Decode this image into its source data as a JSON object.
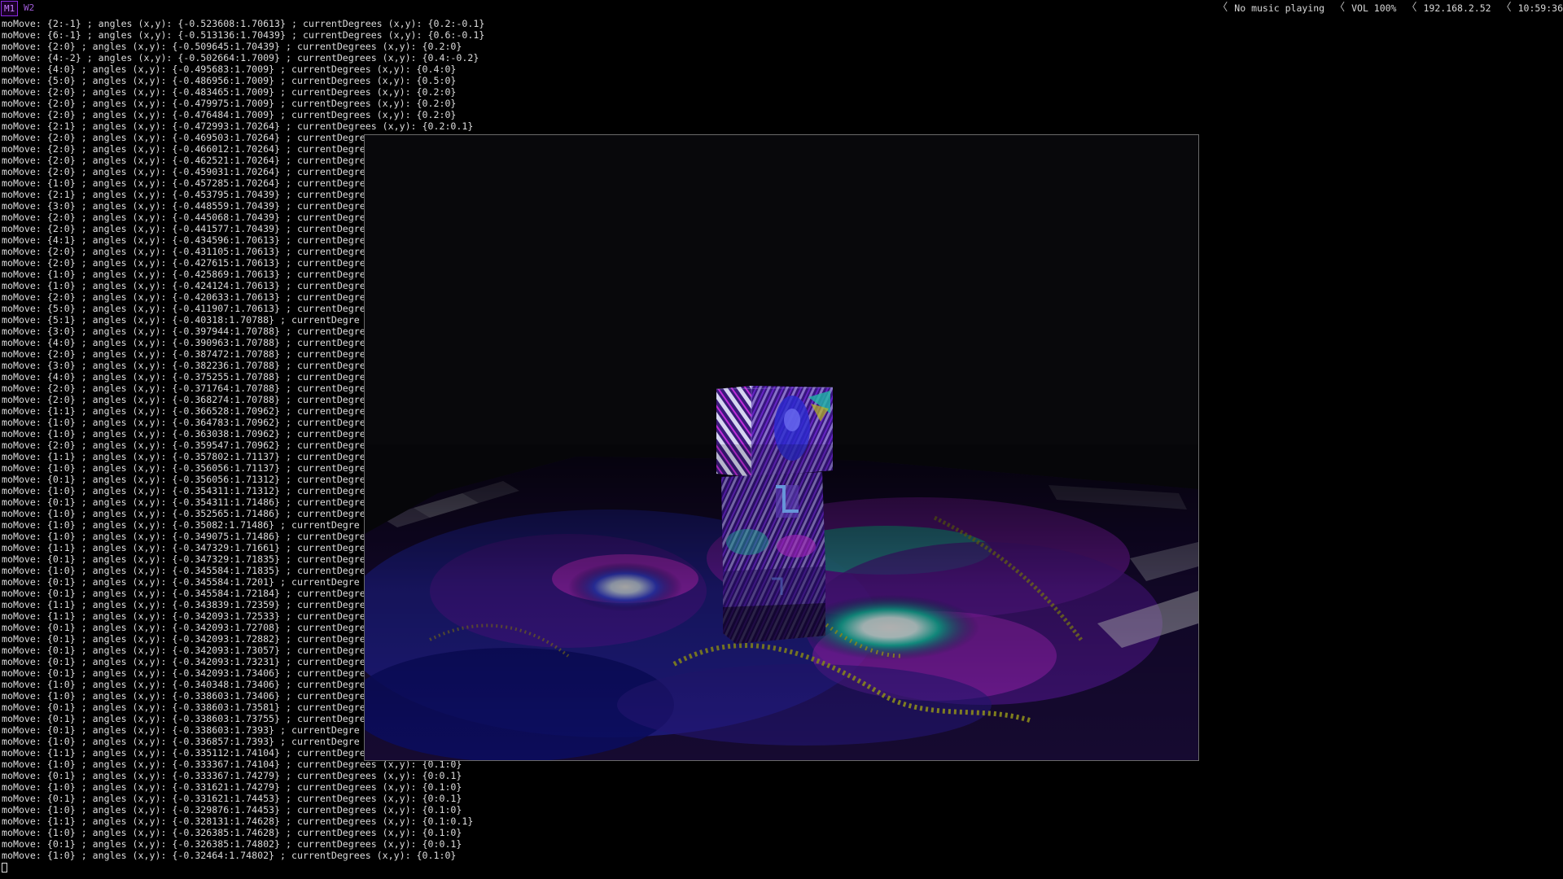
{
  "topbar": {
    "workspaces": [
      {
        "label": "M1",
        "active": true
      },
      {
        "label": "W2",
        "active": false
      }
    ],
    "status": {
      "music": "No music playing",
      "volume": "VOL 100%",
      "ip": "192.168.2.52",
      "time": "10:59:36",
      "separator": "〈"
    }
  },
  "terminal": {
    "lines": [
      "moMove: {2:-1} ; angles (x,y): {-0.523608:1.70613} ; currentDegrees (x,y): {0.2:-0.1}",
      "moMove: {6:-1} ; angles (x,y): {-0.513136:1.70439} ; currentDegrees (x,y): {0.6:-0.1}",
      "moMove: {2:0} ; angles (x,y): {-0.509645:1.70439} ; currentDegrees (x,y): {0.2:0}",
      "moMove: {4:-2} ; angles (x,y): {-0.502664:1.7009} ; currentDegrees (x,y): {0.4:-0.2}",
      "moMove: {4:0} ; angles (x,y): {-0.495683:1.7009} ; currentDegrees (x,y): {0.4:0}",
      "moMove: {5:0} ; angles (x,y): {-0.486956:1.7009} ; currentDegrees (x,y): {0.5:0}",
      "moMove: {2:0} ; angles (x,y): {-0.483465:1.7009} ; currentDegrees (x,y): {0.2:0}",
      "moMove: {2:0} ; angles (x,y): {-0.479975:1.7009} ; currentDegrees (x,y): {0.2:0}",
      "moMove: {2:0} ; angles (x,y): {-0.476484:1.7009} ; currentDegrees (x,y): {0.2:0}",
      "moMove: {2:1} ; angles (x,y): {-0.472993:1.70264} ; currentDegrees (x,y): {0.2:0.1}",
      "moMove: {2:0} ; angles (x,y): {-0.469503:1.70264} ; currentDegre",
      "moMove: {2:0} ; angles (x,y): {-0.466012:1.70264} ; currentDegre",
      "moMove: {2:0} ; angles (x,y): {-0.462521:1.70264} ; currentDegre",
      "moMove: {2:0} ; angles (x,y): {-0.459031:1.70264} ; currentDegre",
      "moMove: {1:0} ; angles (x,y): {-0.457285:1.70264} ; currentDegre",
      "moMove: {2:1} ; angles (x,y): {-0.453795:1.70439} ; currentDegre",
      "moMove: {3:0} ; angles (x,y): {-0.448559:1.70439} ; currentDegre",
      "moMove: {2:0} ; angles (x,y): {-0.445068:1.70439} ; currentDegre",
      "moMove: {2:0} ; angles (x,y): {-0.441577:1.70439} ; currentDegre",
      "moMove: {4:1} ; angles (x,y): {-0.434596:1.70613} ; currentDegre",
      "moMove: {2:0} ; angles (x,y): {-0.431105:1.70613} ; currentDegre",
      "moMove: {2:0} ; angles (x,y): {-0.427615:1.70613} ; currentDegre",
      "moMove: {1:0} ; angles (x,y): {-0.425869:1.70613} ; currentDegre",
      "moMove: {1:0} ; angles (x,y): {-0.424124:1.70613} ; currentDegre",
      "moMove: {2:0} ; angles (x,y): {-0.420633:1.70613} ; currentDegre",
      "moMove: {5:0} ; angles (x,y): {-0.411907:1.70613} ; currentDegre",
      "moMove: {5:1} ; angles (x,y): {-0.40318:1.70788} ; currentDegre",
      "moMove: {3:0} ; angles (x,y): {-0.397944:1.70788} ; currentDegre",
      "moMove: {4:0} ; angles (x,y): {-0.390963:1.70788} ; currentDegre",
      "moMove: {2:0} ; angles (x,y): {-0.387472:1.70788} ; currentDegre",
      "moMove: {3:0} ; angles (x,y): {-0.382236:1.70788} ; currentDegre",
      "moMove: {4:0} ; angles (x,y): {-0.375255:1.70788} ; currentDegre",
      "moMove: {2:0} ; angles (x,y): {-0.371764:1.70788} ; currentDegre",
      "moMove: {2:0} ; angles (x,y): {-0.368274:1.70788} ; currentDegre",
      "moMove: {1:1} ; angles (x,y): {-0.366528:1.70962} ; currentDegre",
      "moMove: {1:0} ; angles (x,y): {-0.364783:1.70962} ; currentDegre",
      "moMove: {1:0} ; angles (x,y): {-0.363038:1.70962} ; currentDegre",
      "moMove: {2:0} ; angles (x,y): {-0.359547:1.70962} ; currentDegre",
      "moMove: {1:1} ; angles (x,y): {-0.357802:1.71137} ; currentDegre",
      "moMove: {1:0} ; angles (x,y): {-0.356056:1.71137} ; currentDegre",
      "moMove: {0:1} ; angles (x,y): {-0.356056:1.71312} ; currentDegre",
      "moMove: {1:0} ; angles (x,y): {-0.354311:1.71312} ; currentDegre",
      "moMove: {0:1} ; angles (x,y): {-0.354311:1.71486} ; currentDegre",
      "moMove: {1:0} ; angles (x,y): {-0.352565:1.71486} ; currentDegre",
      "moMove: {1:0} ; angles (x,y): {-0.35082:1.71486} ; currentDegre",
      "moMove: {1:0} ; angles (x,y): {-0.349075:1.71486} ; currentDegre",
      "moMove: {1:1} ; angles (x,y): {-0.347329:1.71661} ; currentDegre",
      "moMove: {0:1} ; angles (x,y): {-0.347329:1.71835} ; currentDegre",
      "moMove: {1:0} ; angles (x,y): {-0.345584:1.71835} ; currentDegre",
      "moMove: {0:1} ; angles (x,y): {-0.345584:1.7201} ; currentDegre",
      "moMove: {0:1} ; angles (x,y): {-0.345584:1.72184} ; currentDegre",
      "moMove: {1:1} ; angles (x,y): {-0.343839:1.72359} ; currentDegre",
      "moMove: {1:1} ; angles (x,y): {-0.342093:1.72533} ; currentDegre",
      "moMove: {0:1} ; angles (x,y): {-0.342093:1.72708} ; currentDegre",
      "moMove: {0:1} ; angles (x,y): {-0.342093:1.72882} ; currentDegre",
      "moMove: {0:1} ; angles (x,y): {-0.342093:1.73057} ; currentDegre",
      "moMove: {0:1} ; angles (x,y): {-0.342093:1.73231} ; currentDegre",
      "moMove: {0:1} ; angles (x,y): {-0.342093:1.73406} ; currentDegre",
      "moMove: {1:0} ; angles (x,y): {-0.340348:1.73406} ; currentDegre",
      "moMove: {1:0} ; angles (x,y): {-0.338603:1.73406} ; currentDegre",
      "moMove: {0:1} ; angles (x,y): {-0.338603:1.73581} ; currentDegre",
      "moMove: {0:1} ; angles (x,y): {-0.338603:1.73755} ; currentDegre",
      "moMove: {0:1} ; angles (x,y): {-0.338603:1.7393} ; currentDegre",
      "moMove: {1:0} ; angles (x,y): {-0.336857:1.7393} ; currentDegre",
      "moMove: {1:1} ; angles (x,y): {-0.335112:1.74104} ; currentDegre",
      "moMove: {1:0} ; angles (x,y): {-0.333367:1.74104} ; currentDegrees (x,y): {0.1:0}",
      "moMove: {0:1} ; angles (x,y): {-0.333367:1.74279} ; currentDegrees (x,y): {0:0.1}",
      "moMove: {1:0} ; angles (x,y): {-0.331621:1.74279} ; currentDegrees (x,y): {0.1:0}",
      "moMove: {0:1} ; angles (x,y): {-0.331621:1.74453} ; currentDegrees (x,y): {0:0.1}",
      "moMove: {1:0} ; angles (x,y): {-0.329876:1.74453} ; currentDegrees (x,y): {0.1:0}",
      "moMove: {1:1} ; angles (x,y): {-0.328131:1.74628} ; currentDegrees (x,y): {0.1:0.1}",
      "moMove: {1:0} ; angles (x,y): {-0.326385:1.74628} ; currentDegrees (x,y): {0.1:0}",
      "moMove: {0:1} ; angles (x,y): {-0.326385:1.74802} ; currentDegrees (x,y): {0:0.1}",
      "moMove: {1:0} ; angles (x,y): {-0.32464:1.74802} ; currentDegrees (x,y): {0.1:0}"
    ]
  },
  "render_window": {
    "description_colors": {
      "floor_base": "#1c0e3a",
      "accent_blue": "#2b3bd6",
      "accent_magenta": "#c02bd9",
      "accent_teal": "#1fb6a6",
      "accent_yellow": "#b8b820"
    }
  }
}
